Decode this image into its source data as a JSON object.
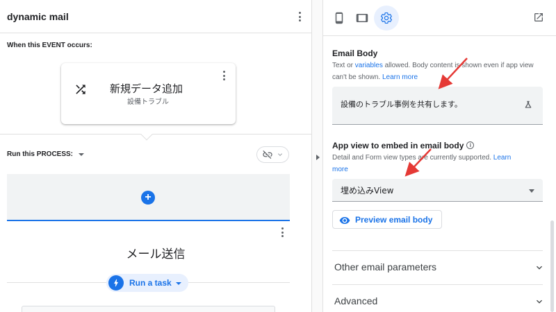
{
  "app": {
    "title": "dynamic mail"
  },
  "event": {
    "section_label": "When this EVENT occurs:",
    "name": "新規データ追加",
    "table": "設備トラブル",
    "icon": "shuffle-icon"
  },
  "process": {
    "section_label": "Run this PROCESS:",
    "link_icon": "link-off-icon",
    "add_icon": "add-circle-icon"
  },
  "step": {
    "title": "メール送信",
    "task_label": "Run a task",
    "task_icon": "bolt-icon"
  },
  "right_panel": {
    "tabs": [
      {
        "name": "phone",
        "icon": "phone-icon"
      },
      {
        "name": "tablet",
        "icon": "tablet-icon"
      },
      {
        "name": "settings",
        "icon": "gear-icon",
        "active": true
      }
    ],
    "open_icon": "open-in-new-icon",
    "email_body": {
      "title": "Email Body",
      "help_pre": "Text or ",
      "help_link": "variables",
      "help_mid": " allowed. Body content is shown even if app view can't be shown. ",
      "help_learn": "Learn more",
      "value": "設備のトラブル事例を共有します。",
      "icon": "flask-icon"
    },
    "app_view": {
      "title": "App view to embed in email body",
      "help_text": "Detail and Form view types are currently supported. ",
      "help_learn_1": "Learn",
      "help_learn_2": "more",
      "selected": "埋め込みView"
    },
    "preview_button": "Preview email body",
    "sections": [
      {
        "label": "Other email parameters"
      },
      {
        "label": "Advanced"
      }
    ]
  },
  "colors": {
    "accent": "#1a73e8",
    "annotation_arrow": "#e53935"
  }
}
